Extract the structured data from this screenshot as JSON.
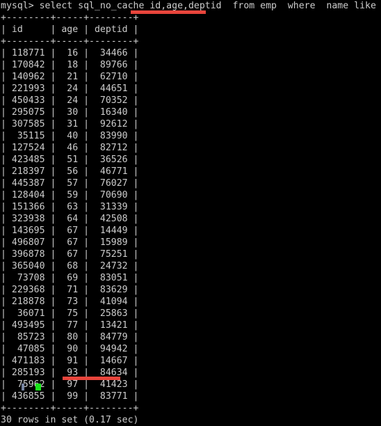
{
  "terminal": {
    "prompt": "mysql>",
    "command_line": "mysql> select sql_no_cache id,age,deptid  from emp  where  name like '%abc';",
    "query": {
      "keyword_select": "select",
      "hint": "sql_no_cache",
      "columns": "id,age,deptid",
      "from_clause": "from emp",
      "where_clause": "where  name like '%abc';"
    },
    "border_top": "+--------+-----+--------+",
    "header_row": "| id     | age | deptid |",
    "border_header": "+--------+-----+--------+",
    "border_bottom": "+--------+-----+--------+",
    "status_line": "30 rows in set (0.17 sec)",
    "row_count": "30",
    "elapsed_time": "0.17 sec",
    "columns": [
      "id",
      "age",
      "deptid"
    ],
    "rows": [
      [
        "118771",
        "16",
        "34466"
      ],
      [
        "170842",
        "18",
        "89766"
      ],
      [
        "140962",
        "21",
        "62710"
      ],
      [
        "221993",
        "24",
        "44651"
      ],
      [
        "450433",
        "24",
        "70352"
      ],
      [
        "295075",
        "30",
        "16340"
      ],
      [
        "307585",
        "31",
        "92612"
      ],
      [
        "35115",
        "40",
        "83990"
      ],
      [
        "127524",
        "46",
        "82712"
      ],
      [
        "423485",
        "51",
        "36526"
      ],
      [
        "218397",
        "56",
        "46771"
      ],
      [
        "445387",
        "57",
        "76027"
      ],
      [
        "128404",
        "59",
        "70690"
      ],
      [
        "151366",
        "63",
        "31339"
      ],
      [
        "323938",
        "64",
        "42508"
      ],
      [
        "143695",
        "67",
        "14449"
      ],
      [
        "496807",
        "67",
        "15989"
      ],
      [
        "396878",
        "67",
        "75251"
      ],
      [
        "365040",
        "68",
        "24732"
      ],
      [
        "73708",
        "69",
        "83051"
      ],
      [
        "229368",
        "71",
        "83629"
      ],
      [
        "218878",
        "73",
        "41094"
      ],
      [
        "36071",
        "75",
        "25863"
      ],
      [
        "493495",
        "77",
        "13421"
      ],
      [
        "85723",
        "80",
        "84779"
      ],
      [
        "47085",
        "90",
        "94942"
      ],
      [
        "471183",
        "91",
        "14667"
      ],
      [
        "285193",
        "93",
        "84634"
      ],
      [
        "75962",
        "97",
        "41423"
      ],
      [
        "436855",
        "99",
        "83771"
      ]
    ]
  },
  "annotations": {
    "underline_columns_label": "id,age,deptid",
    "underline_timing_label": "(0.17 sec)",
    "accent_color": "#e8453c"
  },
  "colors": {
    "background": "#000000",
    "foreground": "#cccccc",
    "cursor": "#19e519",
    "annotation": "#e8453c"
  }
}
